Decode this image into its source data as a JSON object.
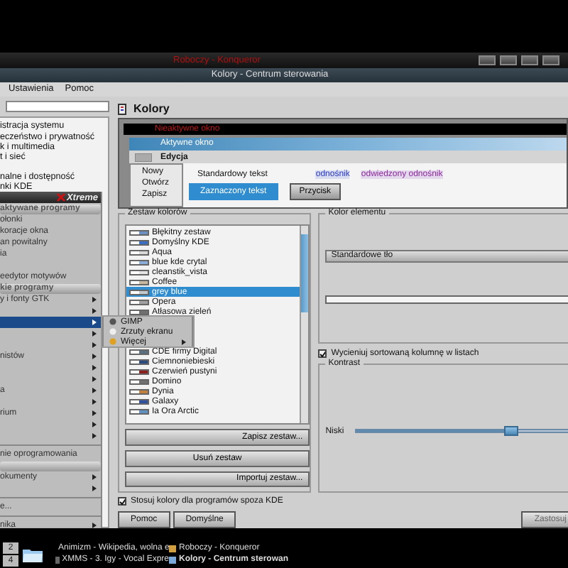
{
  "background_window": {
    "title": "Roboczy - Konqueror"
  },
  "window": {
    "title": "Kolory - Centrum sterowania"
  },
  "menubar": [
    "Ustawienia",
    "Pomoc"
  ],
  "sidebar": {
    "items": [
      "istracja systemu",
      "eczeństwo i prywatność",
      "k i multimedia",
      "t i sieć",
      "nalne i dostępność",
      "nki KDE"
    ]
  },
  "module": {
    "title": "Kolory"
  },
  "preview": {
    "inactive_title": "Nieaktywne okno",
    "active_title": "Aktywne okno",
    "menu": "Edycja",
    "menu_items": [
      "Nowy",
      "Otwórz",
      "Zapisz"
    ],
    "standard_text": "Standardowy tekst",
    "selected_text": "Zaznaczony tekst",
    "link": "odnośnik",
    "visited_link": "odwiedzony odnośnik",
    "button": "Przycisk"
  },
  "color_schemes": {
    "title": "Zestaw kolorów",
    "items": [
      {
        "kind": "scheme",
        "label": "Błękitny zestaw",
        "color": "#6a8fc0",
        "selected": false
      },
      {
        "kind": "scheme",
        "label": "Domyślny KDE",
        "color": "#3a6ec0",
        "selected": false
      },
      {
        "kind": "scheme",
        "label": "Aqua",
        "color": "#d8d8d8",
        "selected": false
      },
      {
        "kind": "scheme",
        "label": "blue kde crytal",
        "color": "#8aaed8",
        "selected": false
      },
      {
        "kind": "scheme",
        "label": "cleanstik_vista",
        "color": "#e4e4e4",
        "selected": false
      },
      {
        "kind": "scheme",
        "label": "Coffee",
        "color": "#c8b8a0",
        "selected": false
      },
      {
        "kind": "scheme",
        "label": "grey blue",
        "color": "#c0c8d0",
        "selected": true
      },
      {
        "kind": "scheme",
        "label": "Opera",
        "color": "#a0a0a0",
        "selected": false
      },
      {
        "kind": "scheme",
        "label": "Atłasowa zieleń",
        "color": "#707070",
        "selected": false
      },
      {
        "kind": "covered"
      },
      {
        "kind": "covered"
      },
      {
        "kind": "covered"
      },
      {
        "kind": "scheme",
        "label": "CDE firmy Digital",
        "color": "#5a7080",
        "selected": false
      },
      {
        "kind": "scheme",
        "label": "Ciemnoniebieski",
        "color": "#2a4a80",
        "selected": false
      },
      {
        "kind": "scheme",
        "label": "Czerwień pustyni",
        "color": "#8a2020",
        "selected": false
      },
      {
        "kind": "scheme",
        "label": "Domino",
        "color": "#707070",
        "selected": false
      },
      {
        "kind": "scheme",
        "label": "Dynia",
        "color": "#c08040",
        "selected": false
      },
      {
        "kind": "scheme",
        "label": "Galaxy",
        "color": "#3050a0",
        "selected": false
      },
      {
        "kind": "scheme",
        "label": "Ia Ora Arctic",
        "color": "#6090c0",
        "selected": false
      }
    ],
    "buttons": [
      "Zapisz zestaw...",
      "Usuń zestaw",
      "Importuj zestaw..."
    ]
  },
  "apply_outside_kde": {
    "label": "Stosuj kolory dla programów spoza KDE",
    "checked": true
  },
  "element_color": {
    "title": "Kolor elementu",
    "element": "Standardowe tło"
  },
  "shade_sorted": {
    "label": "Wycieniuj sortowaną kolumnę w listach",
    "checked": true
  },
  "contrast": {
    "title": "Kontrast",
    "low_label": "Niski",
    "level": 0.72
  },
  "buttons": [
    {
      "label": "Pomoc",
      "disabled": false
    },
    {
      "label": "Domyślne",
      "disabled": false
    },
    {
      "label": "Zastosuj",
      "disabled": true
    }
  ],
  "start_menu": {
    "title": "Xtreme",
    "items": [
      {
        "kind": "header",
        "label": "aktywane programy"
      },
      {
        "kind": "item",
        "label": "ołonki"
      },
      {
        "kind": "item",
        "label": "koracje okna"
      },
      {
        "kind": "item",
        "label": "an powitalny"
      },
      {
        "kind": "item",
        "label": "ia"
      },
      {
        "kind": "item"
      },
      {
        "kind": "item",
        "label": "eedytor motywów"
      },
      {
        "kind": "header",
        "label": "kie programy"
      },
      {
        "kind": "submenu",
        "label": "y i fonty GTK",
        "selected": false
      },
      {
        "kind": "submenu",
        "selected": false
      },
      {
        "kind": "submenu",
        "selected": true
      },
      {
        "kind": "submenu",
        "selected": false
      },
      {
        "kind": "submenu",
        "selected": false
      },
      {
        "kind": "submenu",
        "label": "nistów",
        "selected": false
      },
      {
        "kind": "submenu",
        "selected": false
      },
      {
        "kind": "submenu",
        "selected": false
      },
      {
        "kind": "submenu",
        "label": "a",
        "selected": false
      },
      {
        "kind": "submenu",
        "selected": false
      },
      {
        "kind": "submenu",
        "label": "rium",
        "selected": false
      },
      {
        "kind": "submenu",
        "selected": false
      },
      {
        "kind": "submenu",
        "selected": false
      },
      {
        "kind": "separator"
      },
      {
        "kind": "item",
        "label": "nie oprogramowania"
      },
      {
        "kind": "header"
      },
      {
        "kind": "submenu",
        "label": "okumenty",
        "selected": false
      },
      {
        "kind": "submenu",
        "selected": false
      },
      {
        "kind": "separator"
      },
      {
        "kind": "item",
        "label": "e..."
      },
      {
        "kind": "separator"
      },
      {
        "kind": "submenu",
        "label": "nika",
        "selected": false
      }
    ]
  },
  "submenu": {
    "items": [
      {
        "label": "GIMP",
        "arrow": false
      },
      {
        "label": "Zrzuty ekranu",
        "arrow": false
      },
      {
        "label": "Więcej",
        "arrow": true
      }
    ]
  },
  "taskbar": {
    "desktops": [
      "2",
      "4"
    ],
    "tasks": [
      {
        "label": "Animizm - Wikipedia, wolna e",
        "active": false
      },
      {
        "label": "Roboczy - Konqueror",
        "active": false
      },
      {
        "label": "XMMS - 3. Igy - Vocal Expre",
        "active": false
      },
      {
        "label": "Kolory - Centrum sterowan",
        "active": true
      }
    ]
  }
}
